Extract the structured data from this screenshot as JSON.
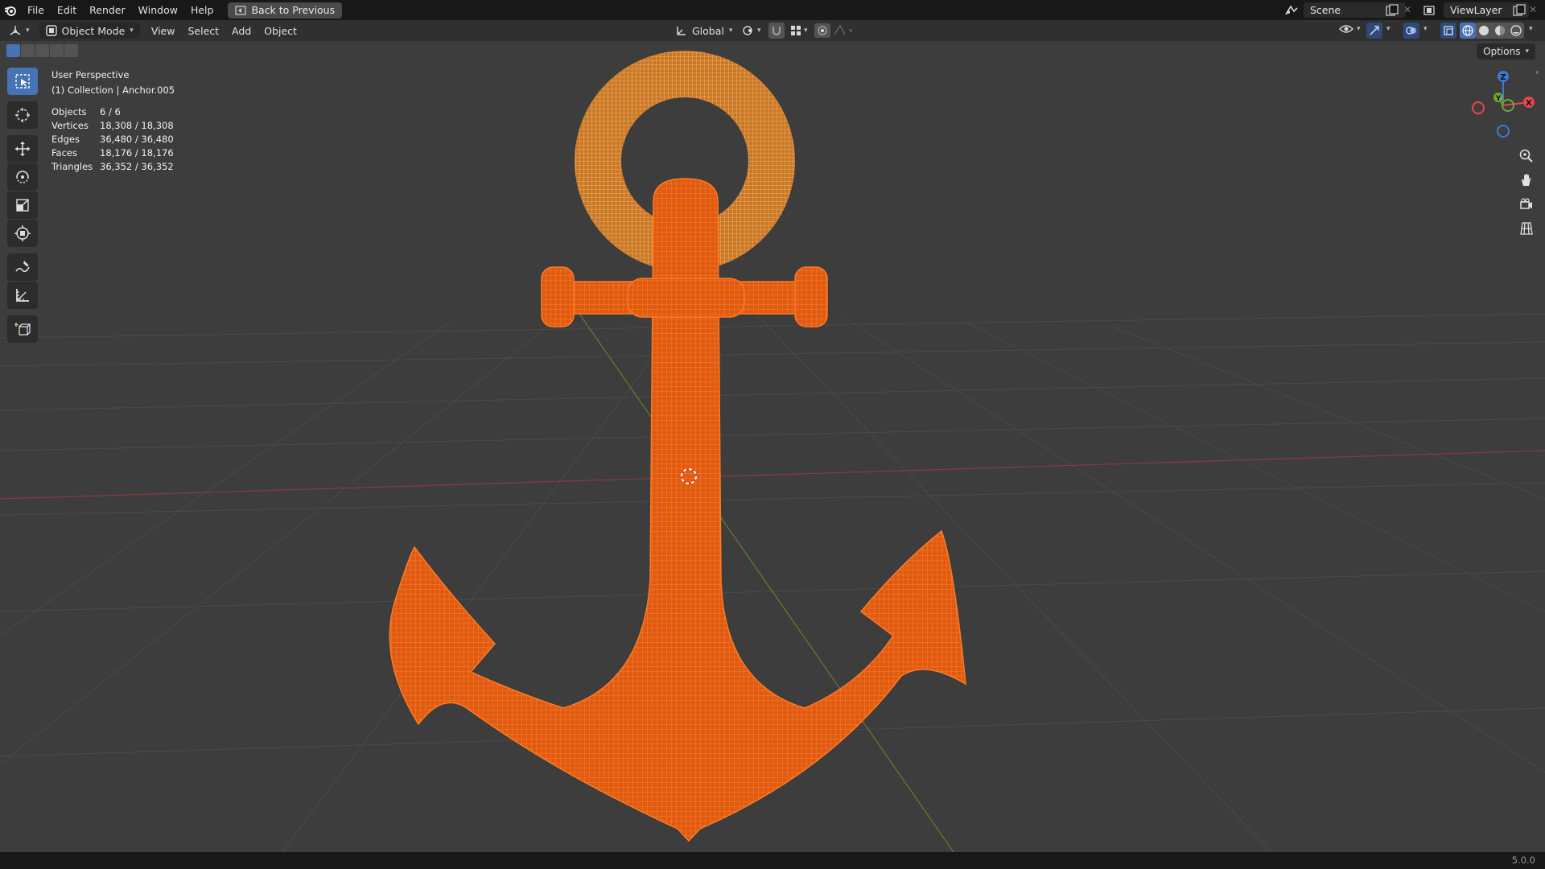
{
  "topbar": {
    "menu": [
      "File",
      "Edit",
      "Render",
      "Window",
      "Help"
    ],
    "back_button": "Back to Previous",
    "scene_label": "Scene",
    "viewlayer_label": "ViewLayer"
  },
  "header": {
    "mode": "Object Mode",
    "menus": [
      "View",
      "Select",
      "Add",
      "Object"
    ],
    "orientation": "Global",
    "options": "Options"
  },
  "overlay": {
    "view_name": "User Perspective",
    "collection": "(1) Collection | Anchor.005",
    "stats": [
      {
        "label": "Objects",
        "value": "6 / 6"
      },
      {
        "label": "Vertices",
        "value": "18,308 / 18,308"
      },
      {
        "label": "Edges",
        "value": "36,480 / 36,480"
      },
      {
        "label": "Faces",
        "value": "18,176 / 18,176"
      },
      {
        "label": "Triangles",
        "value": "36,352 / 36,352"
      }
    ]
  },
  "gizmo": {
    "z": "Z",
    "y": "Y",
    "x": "X"
  },
  "status": {
    "version": "5.0.0"
  },
  "icons": {
    "tools": [
      "select-box-icon",
      "cursor-icon",
      "move-icon",
      "rotate-icon",
      "scale-icon",
      "transform-icon",
      "annotate-icon",
      "measure-icon",
      "add-cube-icon"
    ],
    "nav": [
      "zoom-icon",
      "pan-hand-icon",
      "camera-view-icon",
      "ortho-grid-icon"
    ]
  },
  "colors": {
    "accent": "#4772b3",
    "selected_wire": "#ff6a12",
    "active_ring": "#f5a94a",
    "x_axis": "#e8454f",
    "y_axis": "#6fa636",
    "z_axis": "#3c7ad8"
  }
}
